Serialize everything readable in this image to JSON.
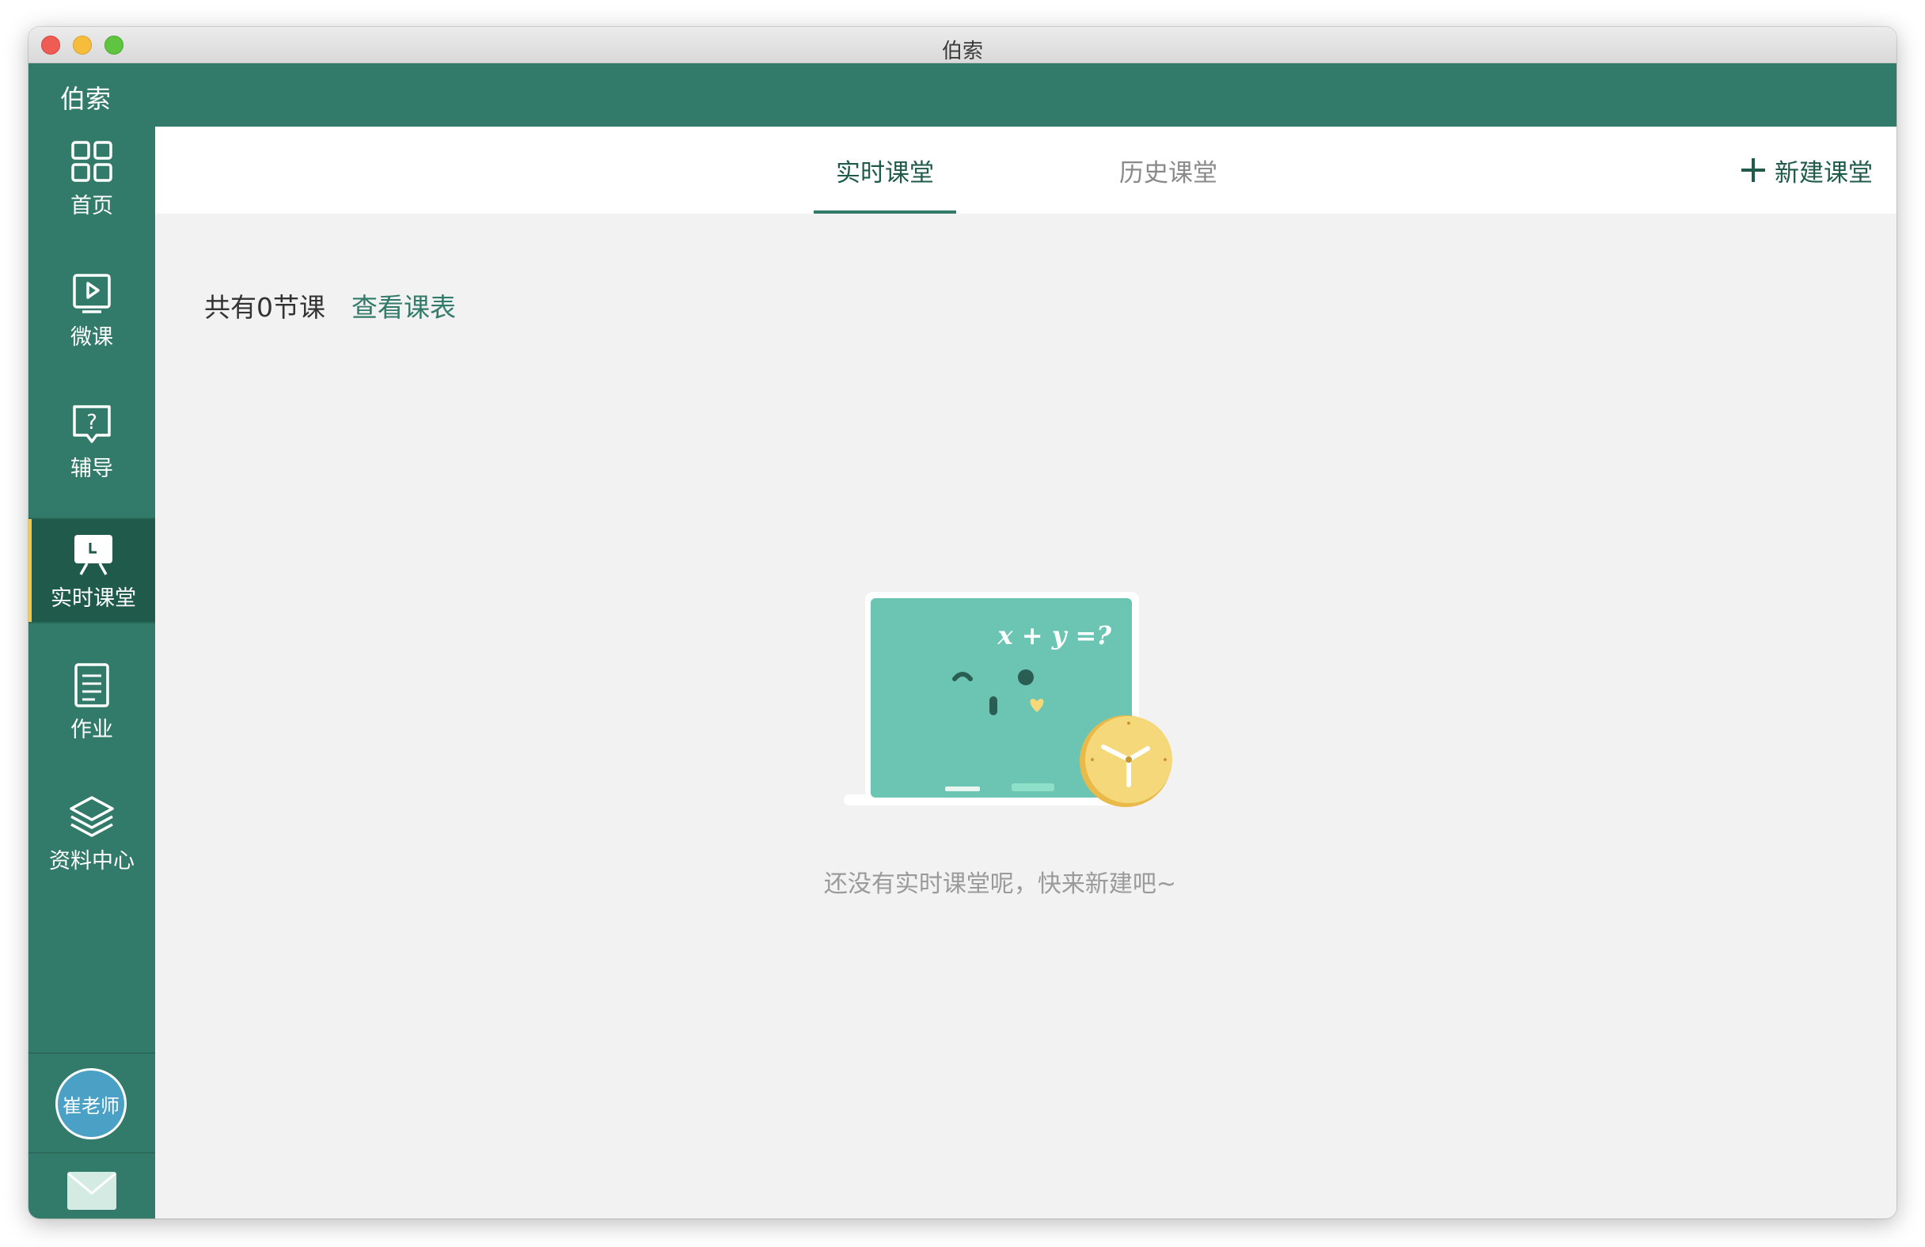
{
  "window": {
    "title": "伯索"
  },
  "app": {
    "name": "伯索"
  },
  "sidebar": {
    "items": [
      {
        "label": "首页",
        "icon": "home-grid-icon"
      },
      {
        "label": "微课",
        "icon": "play-video-icon"
      },
      {
        "label": "辅导",
        "icon": "question-chat-icon"
      },
      {
        "label": "实时课堂",
        "icon": "live-classroom-icon",
        "active": true
      },
      {
        "label": "作业",
        "icon": "document-list-icon"
      },
      {
        "label": "资料中心",
        "icon": "layers-icon"
      }
    ],
    "user": {
      "avatar_text": "崔老师"
    },
    "mail_icon": "mail-icon"
  },
  "tabs": [
    {
      "label": "实时课堂",
      "active": true
    },
    {
      "label": "历史课堂",
      "active": false
    }
  ],
  "toolbar": {
    "new_label": "新建课堂"
  },
  "main": {
    "summary": "共有0节课",
    "view_schedule": "查看课表",
    "empty_text": "还没有实时课堂呢，快来新建吧~",
    "board_formula": "x + y =?"
  },
  "colors": {
    "brand": "#327a69",
    "active_nav": "#1f5a4b",
    "accent_bar": "#f2c94c",
    "board": "#6cc5b3",
    "clock": "#f5d87a"
  }
}
